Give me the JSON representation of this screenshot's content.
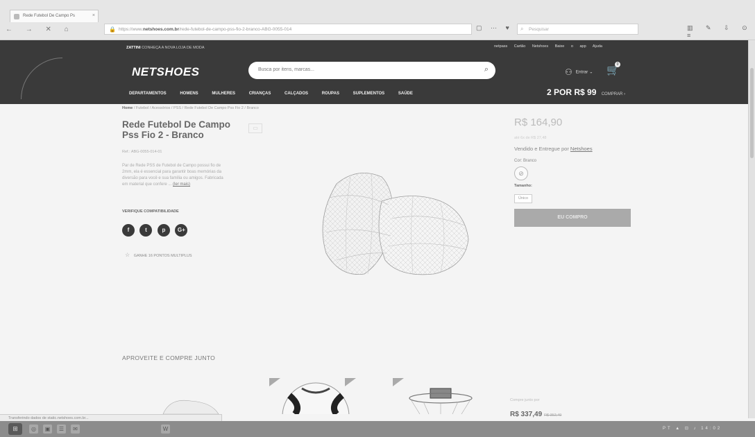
{
  "browser": {
    "tab_title": "Rede Futebol De Campo Ps",
    "tab_close": "×",
    "nav": "←  →  ✕  ⌂",
    "url_prefix": "https://www.",
    "url_domain": "netshoes.com.br",
    "url_path": "/rede-futebol-de-campo-pss-fio-2-branco-ABG-0055-014",
    "search_placeholder": "Pesquisar",
    "toolbar_icons": "▥ ✎ ⇩ ⊙ ≡"
  },
  "site": {
    "topline_brand": "ZATTINI",
    "topline_text": "CONHEÇA A NOVA LOJA DE MODA",
    "top_links": "netpass  Cartão Netshoes  Baixe o app  Ajuda",
    "logo": "NETSHOES",
    "search_placeholder": "Busca por itens, marcas...",
    "account_label": "Entrar",
    "categories": [
      "DEPARTAMENTOS",
      "HOMENS",
      "MULHERES",
      "CRIANÇAS",
      "CALÇADOS",
      "ROUPAS",
      "SUPLEMENTOS",
      "SAÚDE"
    ],
    "promo": "2 POR R$ 99",
    "promo_cta": "COMPRAR ›"
  },
  "product": {
    "breadcrumb_home": "Home",
    "breadcrumb_rest": "/ Futebol / Acessórios / PSS / Rede Futebol De Campo Pss Fio 2 / Branco",
    "title": "Rede Futebol De Campo Pss Fio 2 - Branco",
    "ref": "Ref.: ABG-0055-014-01",
    "description": "Par de Rede PSS de Futebol de Campo possui fio de 2mm, ela é essencial para garantir boas memórias da diversão para você e sua família ou amigos. Fabricada em material que confere ...",
    "more_link": "(ler mais)",
    "verify_label": "VERIFIQUE COMPATIBILIDADE",
    "social": [
      "f",
      "t",
      "p",
      "G+"
    ],
    "points": "GANHE 16 PONTOS MULTIPLUS",
    "price": "R$ 164,90",
    "installments": "até 6x de R$ 27,48",
    "sold_by_prefix": "Vendido e Entregue por",
    "seller": "Netshoes",
    "color_label": "Cor: Branco",
    "size_label": "Tamanho:",
    "size_option": "Único",
    "buy_button": "EU COMPRO"
  },
  "bundle": {
    "section_title": "APROVEITE E COMPRE JUNTO",
    "label": "Compre junto por",
    "price": "R$ 337,49",
    "old_price": "R$ 352,49"
  },
  "status_text": "Transferindo dados de static.netshoes.com.br...",
  "taskbar": {
    "start": "⊞",
    "apps": [
      "◎",
      "▣",
      "☰",
      "✉",
      "W"
    ],
    "tray": "PT ▲ ⊡ ♪ 14:02"
  }
}
